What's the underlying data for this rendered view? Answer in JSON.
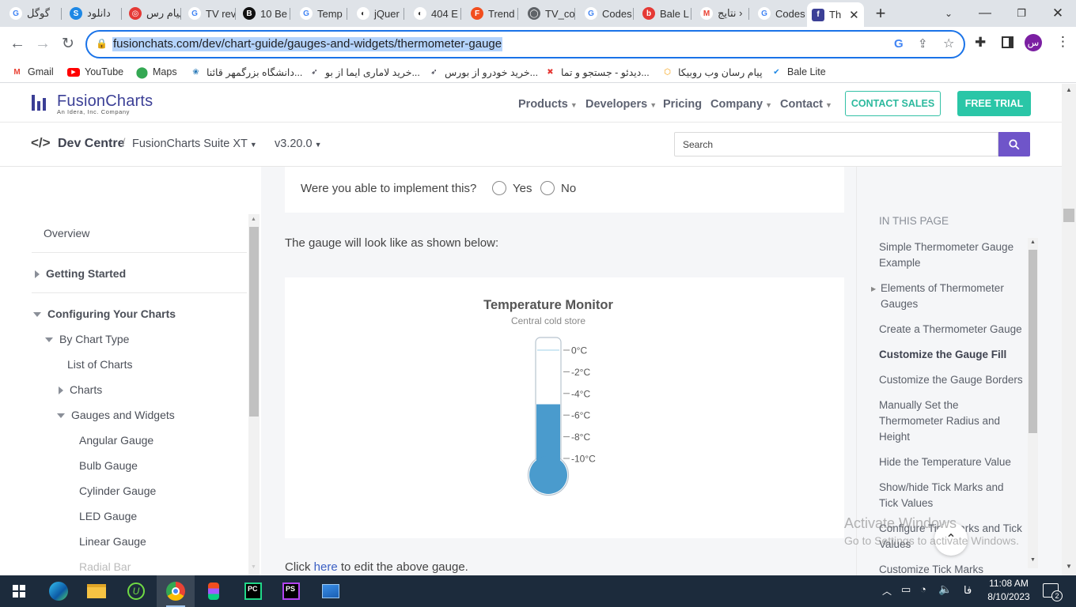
{
  "browser": {
    "tabs": [
      {
        "title": "گوگل",
        "icon": "google-icon"
      },
      {
        "title": "دانلود",
        "icon": "download-site-icon"
      },
      {
        "title": "پیام رس",
        "icon": "rubika-icon"
      },
      {
        "title": "TV rev",
        "icon": "google-icon"
      },
      {
        "title": "10 Be",
        "icon": "bb-icon"
      },
      {
        "title": "Temp",
        "icon": "google-icon"
      },
      {
        "title": "jQuer",
        "icon": "jquery-icon"
      },
      {
        "title": "404 E",
        "icon": "error-icon"
      },
      {
        "title": "Trend",
        "icon": "figma-icon"
      },
      {
        "title": "TV_co",
        "icon": "globe-icon"
      },
      {
        "title": "Codes",
        "icon": "google-icon"
      },
      {
        "title": "Bale L",
        "icon": "bale-icon"
      },
      {
        "title": "نتایج ›",
        "icon": "gmail-icon"
      },
      {
        "title": "Codes",
        "icon": "google-icon"
      },
      {
        "title": "Th",
        "icon": "fusioncharts-icon"
      }
    ],
    "url": "fusionchats.com/dev/chart-guide/gauges-and-widgets/thermometer-gauge",
    "profile_initial": "س",
    "bookmarks": [
      {
        "label": "Gmail",
        "icon": "gmail-icon"
      },
      {
        "label": "YouTube",
        "icon": "youtube-icon"
      },
      {
        "label": "Maps",
        "icon": "maps-icon"
      },
      {
        "label": "دانشگاه بزرگمهر قائنا...",
        "icon": "university-icon"
      },
      {
        "label": "خرید لاماری ایما از بو...",
        "icon": "car-icon"
      },
      {
        "label": "خرید خودرو از بورس...",
        "icon": "car-icon"
      },
      {
        "label": "دیدئو - جستجو و تما...",
        "icon": "video-icon"
      },
      {
        "label": "پیام رسان وب روبیکا",
        "icon": "rubika-icon"
      },
      {
        "label": "Bale Lite",
        "icon": "bale-icon"
      }
    ]
  },
  "site": {
    "logo_name": "FusionCharts",
    "logo_tagline": "An Idera, Inc. Company",
    "nav": [
      "Products",
      "Developers",
      "Pricing",
      "Company",
      "Contact"
    ],
    "contact_sales": "CONTACT SALES",
    "free_trial": "FREE TRIAL",
    "dev_centre": "Dev Centre",
    "breadcrumb_sep": "/",
    "suite": "FusionCharts Suite XT",
    "version": "v3.20.0",
    "search_placeholder": "Search"
  },
  "leftnav": {
    "overview": "Overview",
    "getting_started": "Getting Started",
    "configuring": "Configuring Your Charts",
    "by_chart_type": "By Chart Type",
    "list_of_charts": "List of Charts",
    "charts": "Charts",
    "gauges_widgets": "Gauges and Widgets",
    "items": [
      "Angular Gauge",
      "Bulb Gauge",
      "Cylinder Gauge",
      "LED Gauge",
      "Linear Gauge",
      "Radial Bar"
    ]
  },
  "main": {
    "feedback_question": "Were you able to implement this?",
    "yes": "Yes",
    "no": "No",
    "intro": "The gauge will look like as shown below:",
    "click": "Click",
    "here": "here",
    "edit_suffix": "to edit the above gauge."
  },
  "gauge": {
    "caption": "Temperature Monitor",
    "subcaption": "Central cold store",
    "lower_limit": -10,
    "upper_limit": 0,
    "value": -5,
    "fill_color": "#4a9bcd",
    "ticks": [
      "0°C",
      "-2°C",
      "-4°C",
      "-6°C",
      "-8°C",
      "-10°C"
    ]
  },
  "toc": {
    "heading": "IN THIS PAGE",
    "items": [
      {
        "label": "Simple Thermometer Gauge Example",
        "active": false
      },
      {
        "label": "Elements of Thermometer Gauges",
        "active": false
      },
      {
        "label": "Create a Thermometer Gauge",
        "active": false
      },
      {
        "label": "Customize the Gauge Fill",
        "active": true
      },
      {
        "label": "Customize the Gauge Borders",
        "active": false
      },
      {
        "label": "Manually Set the Thermometer Radius and Height",
        "active": false
      },
      {
        "label": "Hide the Temperature Value",
        "active": false
      },
      {
        "label": "Show/hide Tick Marks and Tick Values",
        "active": false
      },
      {
        "label": "Configure Tick Marks and Tick Values",
        "active": false
      },
      {
        "label": "Customize Tick Marks",
        "active": false
      }
    ]
  },
  "watermark": {
    "line1": "Activate Windows",
    "line2": "Go to Settings to activate Windows."
  },
  "taskbar": {
    "time": "11:08 AM",
    "date": "8/10/2023",
    "lang": "فا",
    "notifications": "2"
  },
  "colors": {
    "accent_purple": "#6f55c9",
    "accent_teal": "#2ac6a7",
    "gauge_fill": "#4a9bcd",
    "omnibox_border": "#1a73e8"
  }
}
